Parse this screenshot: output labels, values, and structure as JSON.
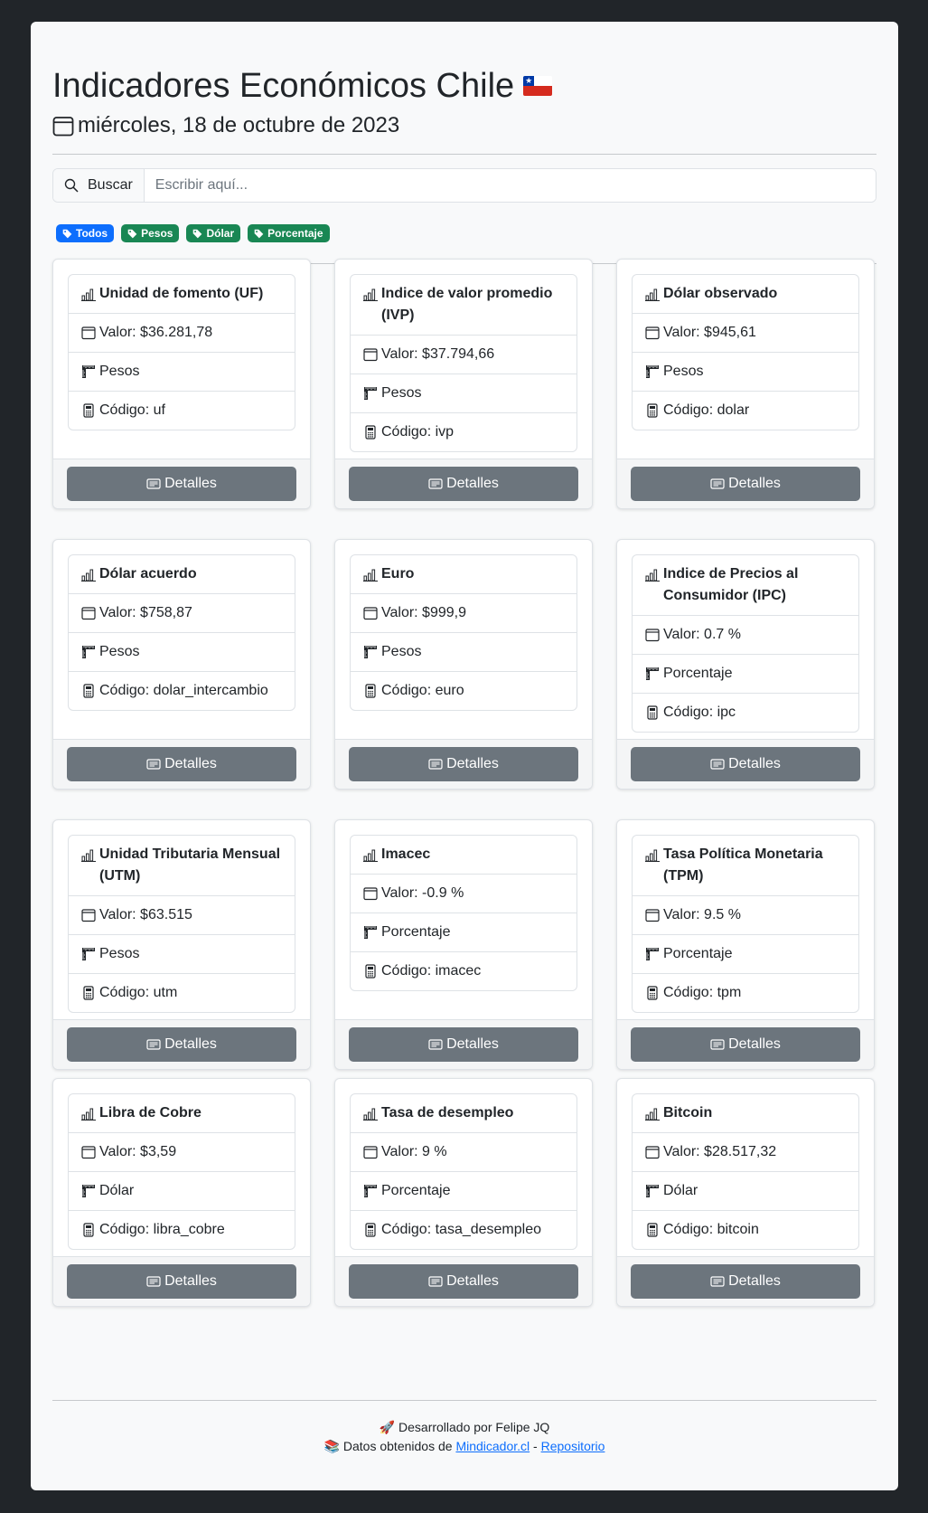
{
  "header": {
    "title": "Indicadores Económicos Chile",
    "date": "miércoles, 18 de octubre de 2023"
  },
  "search": {
    "label": "Buscar",
    "placeholder": "Escribir aquí..."
  },
  "filters": [
    {
      "label": "Todos",
      "color": "#0d6efd"
    },
    {
      "label": "Pesos",
      "color": "#198754"
    },
    {
      "label": "Dólar",
      "color": "#198754"
    },
    {
      "label": "Porcentaje",
      "color": "#198754"
    }
  ],
  "cards": [
    {
      "name": "Unidad de fomento (UF)",
      "valor": "Valor: $36.281,78",
      "unidad": "Pesos",
      "codigo": "Código: uf"
    },
    {
      "name": "Indice de valor promedio (IVP)",
      "valor": "Valor: $37.794,66",
      "unidad": "Pesos",
      "codigo": "Código: ivp"
    },
    {
      "name": "Dólar observado",
      "valor": "Valor: $945,61",
      "unidad": "Pesos",
      "codigo": "Código: dolar"
    },
    {
      "name": "Dólar acuerdo",
      "valor": "Valor: $758,87",
      "unidad": "Pesos",
      "codigo": "Código: dolar_intercambio"
    },
    {
      "name": "Euro",
      "valor": "Valor: $999,9",
      "unidad": "Pesos",
      "codigo": "Código: euro"
    },
    {
      "name": "Indice de Precios al Consumidor (IPC)",
      "valor": "Valor: 0.7 %",
      "unidad": "Porcentaje",
      "codigo": "Código: ipc"
    },
    {
      "name": "Unidad Tributaria Mensual (UTM)",
      "valor": "Valor: $63.515",
      "unidad": "Pesos",
      "codigo": "Código: utm"
    },
    {
      "name": "Imacec",
      "valor": "Valor: -0.9 %",
      "unidad": "Porcentaje",
      "codigo": "Código: imacec"
    },
    {
      "name": "Tasa Política Monetaria (TPM)",
      "valor": "Valor: 9.5 %",
      "unidad": "Porcentaje",
      "codigo": "Código: tpm"
    },
    {
      "name": "Libra de Cobre",
      "valor": "Valor: $3,59",
      "unidad": "Dólar",
      "codigo": "Código: libra_cobre"
    },
    {
      "name": "Tasa de desempleo",
      "valor": "Valor: 9 %",
      "unidad": "Porcentaje",
      "codigo": "Código: tasa_desempleo"
    },
    {
      "name": "Bitcoin",
      "valor": "Valor: $28.517,32",
      "unidad": "Dólar",
      "codigo": "Código: bitcoin"
    }
  ],
  "details_label": "Detalles",
  "footer": {
    "line1": "🚀 Desarrollado por Felipe JQ",
    "prefix": "📚 Datos obtenidos de ",
    "link1": "Mindicador.cl",
    "sep": " - ",
    "link2": "Repositorio"
  }
}
